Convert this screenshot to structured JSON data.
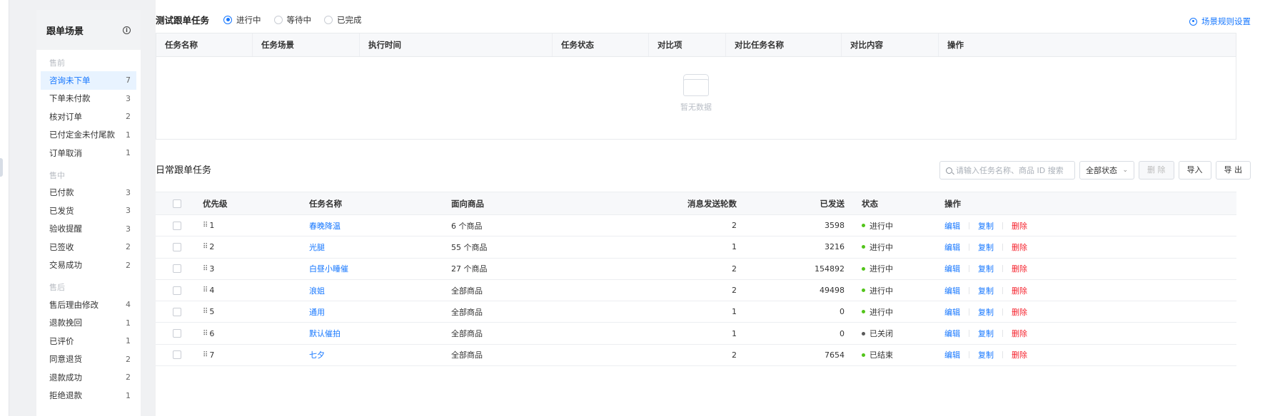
{
  "sidebar": {
    "title": "跟单场景",
    "groups": [
      {
        "label": "售前",
        "items": [
          {
            "label": "咨询未下单",
            "count": "7",
            "active": true
          },
          {
            "label": "下单未付款",
            "count": "3"
          },
          {
            "label": "核对订单",
            "count": "2"
          },
          {
            "label": "已付定金未付尾款",
            "count": "1"
          },
          {
            "label": "订单取消",
            "count": "1"
          }
        ]
      },
      {
        "label": "售中",
        "items": [
          {
            "label": "已付款",
            "count": "3"
          },
          {
            "label": "已发货",
            "count": "3"
          },
          {
            "label": "验收提醒",
            "count": "3"
          },
          {
            "label": "已签收",
            "count": "2"
          },
          {
            "label": "交易成功",
            "count": "2"
          }
        ]
      },
      {
        "label": "售后",
        "items": [
          {
            "label": "售后理由修改",
            "count": "4"
          },
          {
            "label": "退款挽回",
            "count": "1"
          },
          {
            "label": "已评价",
            "count": "1"
          },
          {
            "label": "同意退货",
            "count": "2"
          },
          {
            "label": "退款成功",
            "count": "2"
          },
          {
            "label": "拒绝退款",
            "count": "1"
          }
        ]
      }
    ]
  },
  "test_section": {
    "title": "测试跟单任务",
    "radios": [
      {
        "label": "进行中",
        "checked": true
      },
      {
        "label": "等待中",
        "checked": false
      },
      {
        "label": "已完成",
        "checked": false
      }
    ],
    "rule_link": "场景规则设置",
    "columns": [
      "任务名称",
      "任务场景",
      "执行时间",
      "任务状态",
      "对比项",
      "对比任务名称",
      "对比内容",
      "操作"
    ],
    "empty_text": "暂无数据"
  },
  "daily_section": {
    "title": "日常跟单任务",
    "search_placeholder": "请输入任务名称、商品 ID 搜索",
    "status_filter": "全部状态",
    "buttons": {
      "delete": "删 除",
      "import": "导入",
      "export": "导 出"
    },
    "columns": {
      "priority": "优先级",
      "name": "任务名称",
      "goods": "面向商品",
      "rounds": "消息发送轮数",
      "sent": "已发送",
      "status": "状态",
      "ops": "操作"
    },
    "ops": {
      "edit": "编辑",
      "copy": "复制",
      "delete": "删除"
    },
    "rows": [
      {
        "priority": "1",
        "name": "春晚降温",
        "goods": "6 个商品",
        "rounds": "2",
        "sent": "3598",
        "status": "进行中",
        "status_color": "#52c41a"
      },
      {
        "priority": "2",
        "name": "光腿",
        "goods": "55 个商品",
        "rounds": "1",
        "sent": "3216",
        "status": "进行中",
        "status_color": "#52c41a"
      },
      {
        "priority": "3",
        "name": "白昼小睡催",
        "goods": "27 个商品",
        "rounds": "2",
        "sent": "154892",
        "status": "进行中",
        "status_color": "#52c41a"
      },
      {
        "priority": "4",
        "name": "浪姐",
        "goods": "全部商品",
        "rounds": "2",
        "sent": "49498",
        "status": "进行中",
        "status_color": "#52c41a"
      },
      {
        "priority": "5",
        "name": "通用",
        "goods": "全部商品",
        "rounds": "1",
        "sent": "0",
        "status": "进行中",
        "status_color": "#52c41a"
      },
      {
        "priority": "6",
        "name": "默认催拍",
        "goods": "全部商品",
        "rounds": "1",
        "sent": "0",
        "status": "已关闭",
        "status_color": "#595959"
      },
      {
        "priority": "7",
        "name": "七夕",
        "goods": "全部商品",
        "rounds": "2",
        "sent": "7654",
        "status": "已结束",
        "status_color": "#52c41a"
      }
    ]
  }
}
